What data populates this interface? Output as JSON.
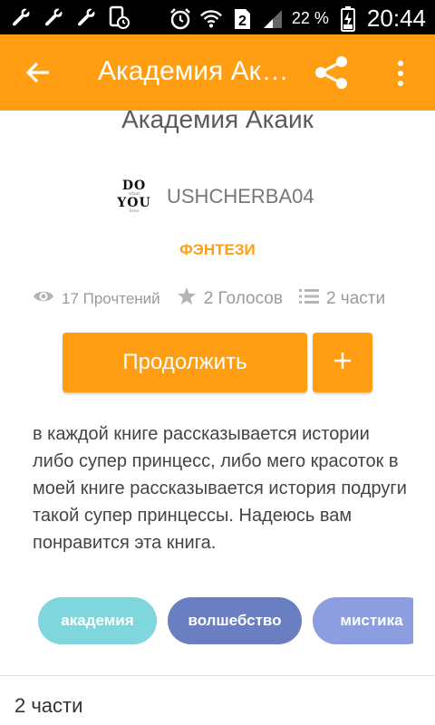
{
  "status_bar": {
    "battery_percent": "22 %",
    "time": "20:44",
    "sim_slot": "2",
    "left_icons": [
      "wrench-icon",
      "wrench-icon",
      "wrench-icon",
      "phone-clock-icon"
    ],
    "right_icons": [
      "alarm-icon",
      "wifi-icon",
      "sim-2-icon",
      "signal-icon",
      "battery-charging-icon"
    ]
  },
  "app_bar": {
    "title": "Академия Акаик",
    "accent_color": "#ff9e12"
  },
  "book": {
    "title": "Академия Акаик",
    "author": "USHCHERBA04",
    "avatar_text": [
      "DO",
      "what",
      "YOU",
      "love"
    ],
    "genre": "ФЭНТЕЗИ",
    "stats": {
      "reads": "17 Прочтений",
      "votes": "2 Голосов",
      "parts": "2 части"
    },
    "continue_label": "Продолжить",
    "description": "в каждой книге рассказывается истории либо супер принцесс, либо мего красоток в моей книге рассказывается история подруги такой супер принцессы. Надеюсь вам понравится эта книга."
  },
  "tags": [
    {
      "label": "академия",
      "color": "#7fd6dd"
    },
    {
      "label": "волшебство",
      "color": "#6a7fc1"
    },
    {
      "label": "мистика",
      "color": "#8c9ee0"
    }
  ],
  "parts_section": {
    "title": "2 части"
  }
}
